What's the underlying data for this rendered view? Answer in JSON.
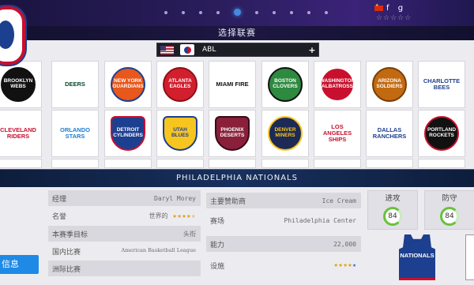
{
  "user": {
    "name": "f g",
    "rating_stars": "☆☆☆☆☆"
  },
  "pager": {
    "count": 10,
    "active_index": 4
  },
  "section_title": "选择联赛",
  "league": {
    "name": "ABL",
    "add_symbol": "+"
  },
  "teams_row1": [
    {
      "label": "BROOKLYN WEBS",
      "fg": "#ffffff",
      "bg": "#111111",
      "border": "#111111"
    },
    {
      "label": "DEERS",
      "fg": "#0a4a2a",
      "bg": "#ffffff",
      "border": "#ffffff",
      "style": "plain"
    },
    {
      "label": "NEW YORK GUARDIANS",
      "fg": "#ffffff",
      "bg": "#e8571b",
      "border": "#1d3f8f"
    },
    {
      "label": "ATLANTA EAGLES",
      "fg": "#ffffff",
      "bg": "#d11f2d",
      "border": "#8e0e18"
    },
    {
      "label": "MIAMI FIRE",
      "fg": "#111111",
      "bg": "#ffffff",
      "border": "#ffffff",
      "style": "plain"
    },
    {
      "label": "BOSTON CLOVERS",
      "fg": "#ffffff",
      "bg": "#2d8a3e",
      "border": "#111111"
    },
    {
      "label": "WASHINGTON ALBATROSS",
      "fg": "#ffffff",
      "bg": "#c8102e",
      "border": "#ffffff"
    },
    {
      "label": "ARIZONA SOLDIERS",
      "fg": "#ffffff",
      "bg": "#c26a12",
      "border": "#7a3d05"
    },
    {
      "label": "CHARLOTTE BEES",
      "fg": "#1d3f8f",
      "bg": "#ffffff",
      "border": "#ffffff",
      "style": "plain"
    }
  ],
  "teams_row2": [
    {
      "label": "CLEVELAND RIDERS",
      "fg": "#c8102e",
      "bg": "#ffffff",
      "border": "#ffffff",
      "style": "plain"
    },
    {
      "label": "ORLANDO STARS",
      "fg": "#1d7ecf",
      "bg": "#ffffff",
      "border": "#ffffff",
      "style": "plain"
    },
    {
      "label": "DETROIT CYLINDERS",
      "fg": "#ffffff",
      "bg": "#1d3f8f",
      "border": "#c8102e",
      "style": "shield"
    },
    {
      "label": "UTAH BLUES",
      "fg": "#1d3f8f",
      "bg": "#f7c520",
      "border": "#1d3f8f",
      "style": "shield"
    },
    {
      "label": "PHOENIX DESERTS",
      "fg": "#ffffff",
      "bg": "#8a1f3a",
      "border": "#3a0a18",
      "style": "shield"
    },
    {
      "label": "DENVER MINERS",
      "fg": "#f7c520",
      "bg": "#1d2a55",
      "border": "#f7c520"
    },
    {
      "label": "LOS ANGELES SHIPS",
      "fg": "#c8102e",
      "bg": "#ffffff",
      "border": "#ffffff",
      "style": "plain"
    },
    {
      "label": "DALLAS RANCHERS",
      "fg": "#1d3f8f",
      "bg": "#ffffff",
      "border": "#ffffff",
      "style": "plain"
    },
    {
      "label": "PORTLAND ROCKETS",
      "fg": "#ffffff",
      "bg": "#111111",
      "border": "#c8102e"
    }
  ],
  "team_detail": {
    "name": "PHILADELPHIA NATIONALS",
    "info_button": "信息",
    "left_rows": [
      {
        "key": "经理",
        "value": "Daryl Morey"
      },
      {
        "key": "名誉",
        "value": "世界的",
        "stars": "★★★★",
        "half_star": "★"
      },
      {
        "key": "本赛季目标",
        "value": "头衔"
      },
      {
        "key": "国内比赛",
        "value": "American Basketball League"
      },
      {
        "key": "洲际比赛",
        "value": ""
      }
    ],
    "right_rows": [
      {
        "key": "主要赞助商",
        "value": "Ice Cream"
      },
      {
        "key": "赛场",
        "value": "Philadelphia Center"
      },
      {
        "key": "能力",
        "value": "22,000"
      },
      {
        "key": "设施",
        "value": "",
        "stars": "★★★★",
        "blue_star": "★"
      }
    ],
    "attack_label": "进攻",
    "attack_value": "84",
    "defense_label": "防守",
    "defense_value": "84",
    "jersey_text": "NATIONALS"
  }
}
